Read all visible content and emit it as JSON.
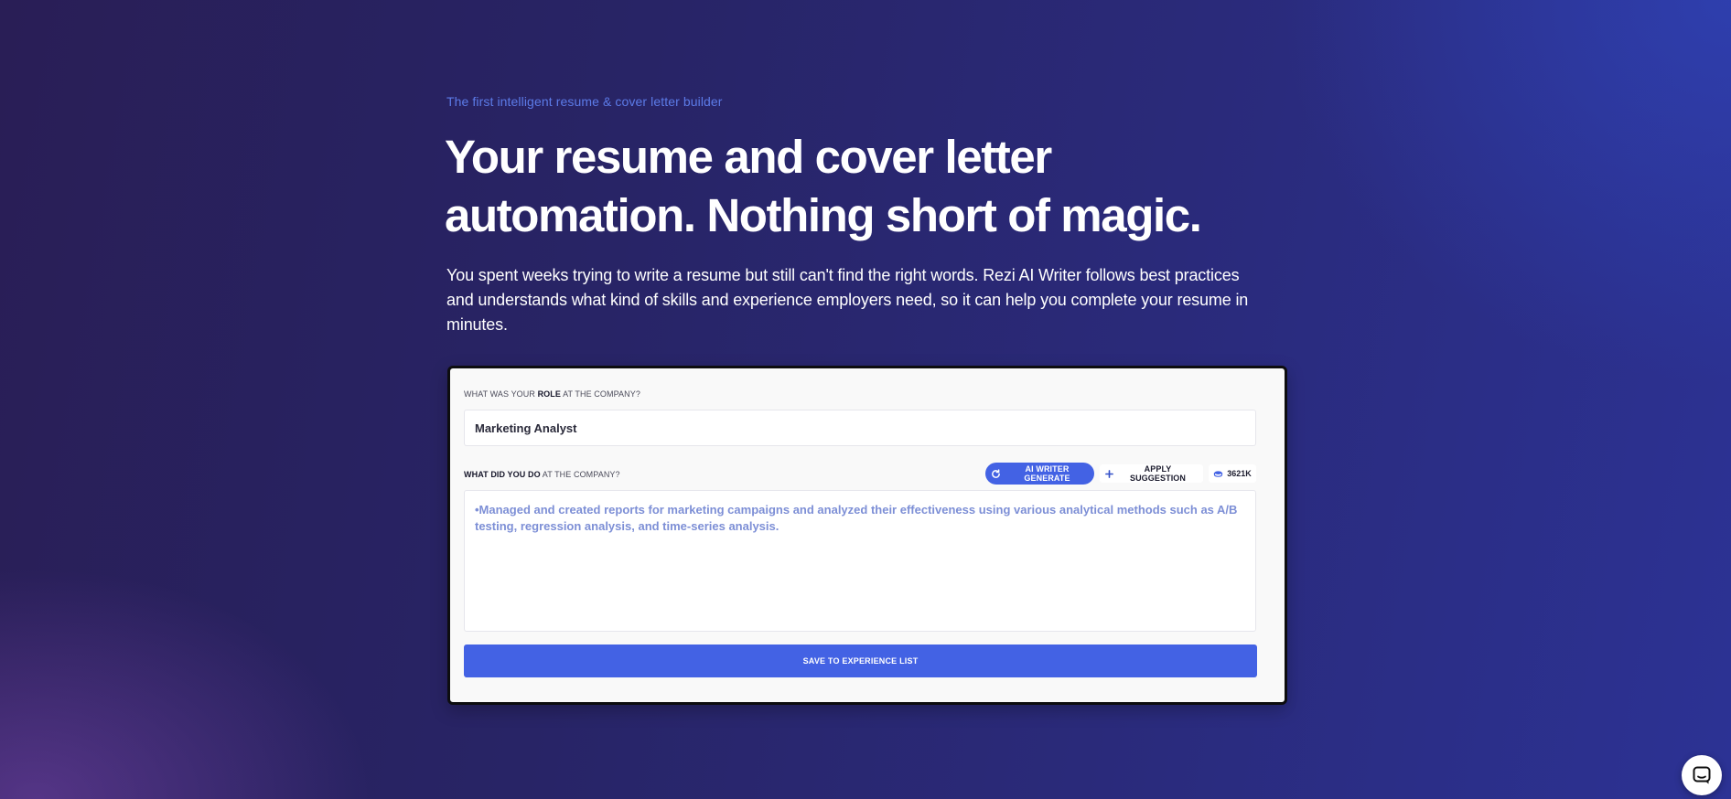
{
  "hero": {
    "eyebrow": "The first intelligent resume & cover letter builder",
    "headline_line1": "Your resume and cover letter",
    "headline_line2": "automation. Nothing short of magic.",
    "subtitle": "You spent weeks trying to write a resume but still can't find the right words. Rezi AI Writer follows best practices and understands what kind of skills and experience employers need, so it can help you complete your resume in minutes."
  },
  "form": {
    "role_label_prefix": "WHAT WAS YOUR ",
    "role_label_bold": "ROLE",
    "role_label_suffix": " AT THE COMPANY?",
    "role_value": "Marketing Analyst",
    "desc_label_bold": "WHAT DID YOU DO",
    "desc_label_suffix": " AT THE COMPANY?",
    "ai_generate_label": "AI WRITER GENERATE",
    "apply_suggestion_label": "APPLY SUGGESTION",
    "credits_value": "3621K",
    "description_value": "•Managed and created reports for marketing campaigns and analyzed their effectiveness using various analytical methods such as A/B testing, regression analysis, and time-series analysis.",
    "save_label": "SAVE TO EXPERIENCE LIST"
  },
  "icons": {
    "ai_generate": "refresh-icon",
    "apply_suggestion": "plus-icon",
    "credits": "coin-stack-icon",
    "chat": "chat-icon"
  },
  "colors": {
    "accent": "#4362e4",
    "eyebrow": "#5c7be8",
    "suggestion_text": "#7d8fd6"
  }
}
